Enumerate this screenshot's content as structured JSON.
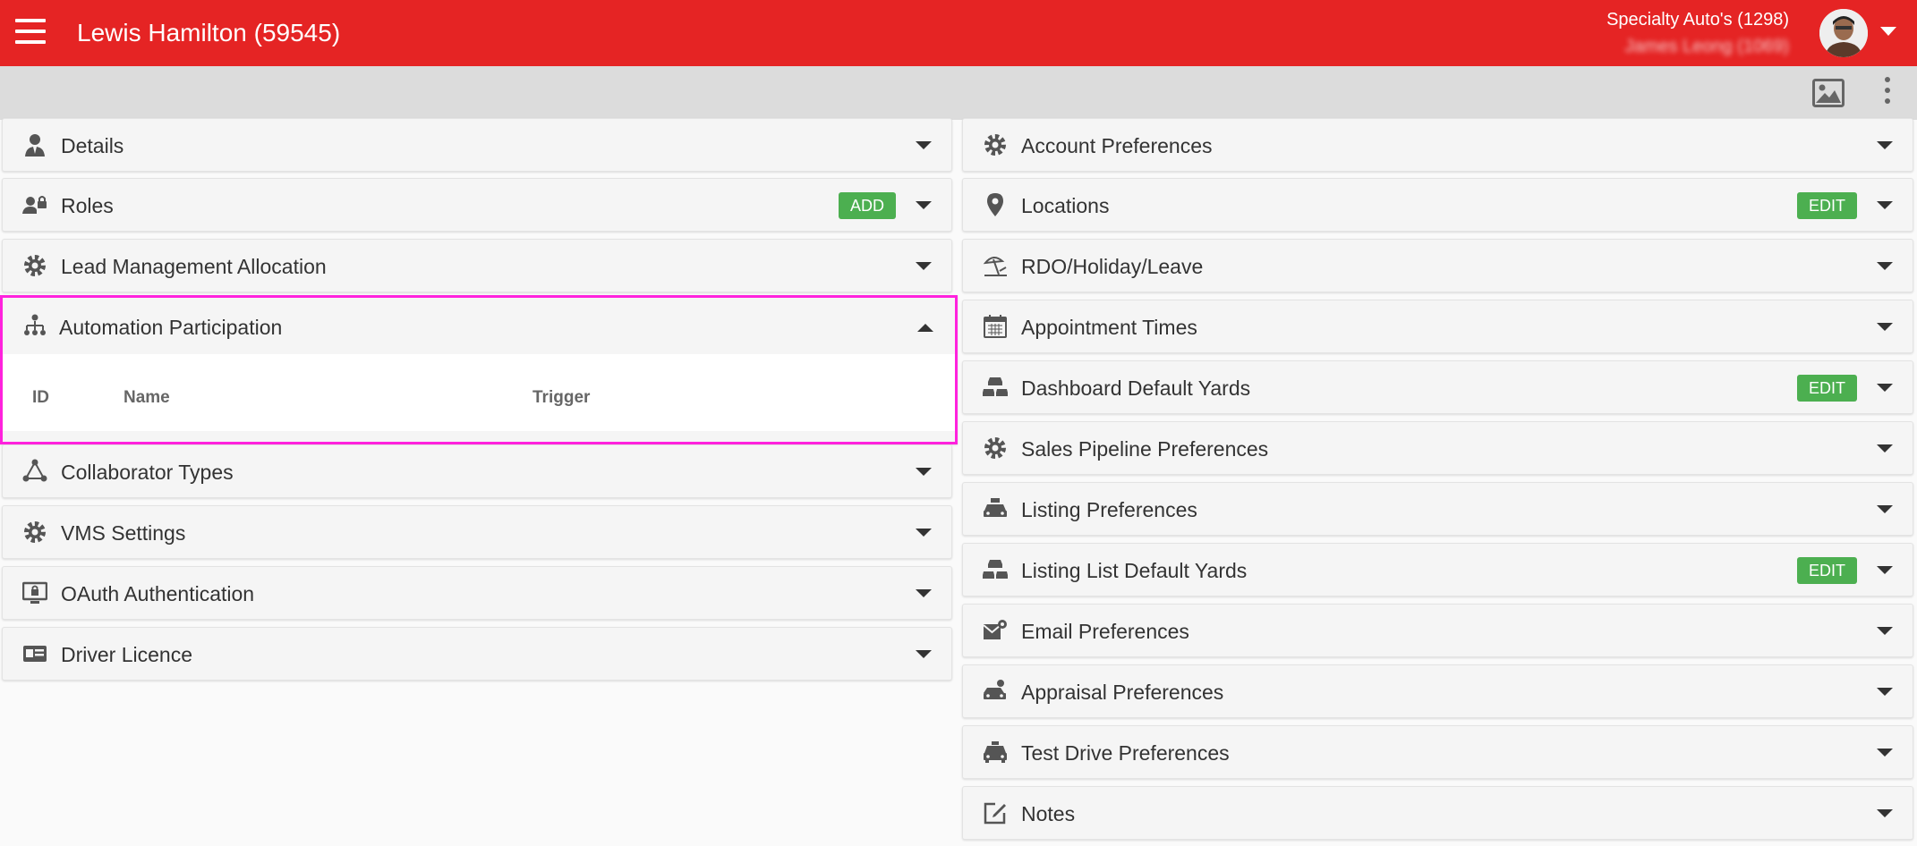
{
  "header": {
    "title": "Lewis Hamilton (59545)",
    "account_name": "Specialty Auto's (1298)",
    "user_name": "James Leong (1069)"
  },
  "colors": {
    "header": "#e52424",
    "badge": "#4caf50",
    "highlight": "#ff22dd"
  },
  "left_panels": {
    "details": {
      "label": "Details",
      "icon": "user-tie-icon"
    },
    "roles": {
      "label": "Roles",
      "icon": "user-lock-icon",
      "action": "ADD"
    },
    "lead": {
      "label": "Lead Management Allocation",
      "icon": "gear-icon"
    },
    "automation": {
      "label": "Automation Participation",
      "icon": "sitemap-icon",
      "expanded": true,
      "columns": [
        "ID",
        "Name",
        "Trigger"
      ]
    },
    "collab": {
      "label": "Collaborator Types",
      "icon": "triangle-users-icon"
    },
    "vms": {
      "label": "VMS Settings",
      "icon": "gear-icon"
    },
    "oauth": {
      "label": "OAuth Authentication",
      "icon": "monitor-lock-icon"
    },
    "licence": {
      "label": "Driver Licence",
      "icon": "id-card-icon"
    }
  },
  "right_panels": {
    "account_prefs": {
      "label": "Account Preferences",
      "icon": "gear-icon"
    },
    "locations": {
      "label": "Locations",
      "icon": "map-pin-icon",
      "action": "EDIT"
    },
    "rdo": {
      "label": "RDO/Holiday/Leave",
      "icon": "beach-umbrella-icon"
    },
    "appt": {
      "label": "Appointment Times",
      "icon": "calendar-icon"
    },
    "dash_yards": {
      "label": "Dashboard Default Yards",
      "icon": "cars-icon",
      "action": "EDIT"
    },
    "sales_pipeline": {
      "label": "Sales Pipeline Preferences",
      "icon": "gear-icon"
    },
    "listing_prefs": {
      "label": "Listing Preferences",
      "icon": "car-sign-icon"
    },
    "listing_yards": {
      "label": "Listing List Default Yards",
      "icon": "cars-icon",
      "action": "EDIT"
    },
    "email": {
      "label": "Email Preferences",
      "icon": "envelope-gear-icon"
    },
    "appraisal": {
      "label": "Appraisal Preferences",
      "icon": "car-dollar-icon"
    },
    "test_drive": {
      "label": "Test Drive Preferences",
      "icon": "taxi-icon"
    },
    "notes": {
      "label": "Notes",
      "icon": "edit-square-icon"
    }
  }
}
